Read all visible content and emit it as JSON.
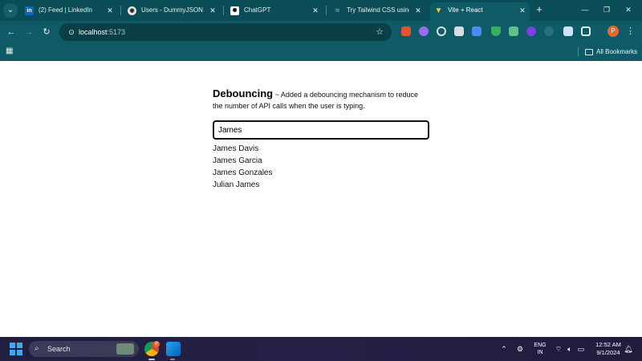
{
  "browser": {
    "tabs": [
      {
        "title": "(2) Feed | LinkedIn",
        "favicon": "linkedin-icon",
        "active": false
      },
      {
        "title": "Users - DummyJSON - Fa",
        "favicon": "github-icon",
        "active": false
      },
      {
        "title": "ChatGPT",
        "favicon": "chatgpt-icon",
        "active": false
      },
      {
        "title": "Try Tailwind CSS using the",
        "favicon": "tailwind-icon",
        "active": false
      },
      {
        "title": "Vite + React",
        "favicon": "vite-icon",
        "active": true
      }
    ],
    "address": {
      "host": "localhost",
      "port": ":5173"
    },
    "bookmarks_label": "All Bookmarks",
    "profile_initial": "P"
  },
  "page": {
    "heading": "Debouncing",
    "description": " ~ Added a debouncing mechanism to reduce the number of API calls when the user is typing.",
    "search_value": "James",
    "results": [
      "James Davis",
      "James Garcia",
      "James Gonzales",
      "Julian James"
    ]
  },
  "taskbar": {
    "search_label": "Search",
    "language_line1": "ENG",
    "language_line2": "IN",
    "time": "12:52 AM",
    "date": "9/1/2024",
    "chrome_badge": "P"
  },
  "colors": {
    "browser_frame": "#0e5a66",
    "tab_strip": "#0b4d57",
    "taskbar": "#232044"
  }
}
